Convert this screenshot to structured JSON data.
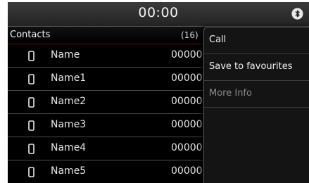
{
  "status": {
    "time": "00:00",
    "bluetooth_icon": "bluetooth-icon"
  },
  "contacts": {
    "title": "Contacts",
    "count": "(16)",
    "items": [
      {
        "name": "Name",
        "number": "00000"
      },
      {
        "name": "Name1",
        "number": "00000"
      },
      {
        "name": "Name2",
        "number": "00000"
      },
      {
        "name": "Name3",
        "number": "00000"
      },
      {
        "name": "Name4",
        "number": "00000"
      },
      {
        "name": "Name5",
        "number": "00000"
      }
    ]
  },
  "menu": {
    "call": "Call",
    "save_to_favourites": "Save to favourites",
    "more_info": "More Info"
  },
  "colors": {
    "background": "#000000",
    "divider": "#4a4a4a",
    "header_accent": "#6e1414",
    "disabled_text": "#8a8a8a"
  }
}
